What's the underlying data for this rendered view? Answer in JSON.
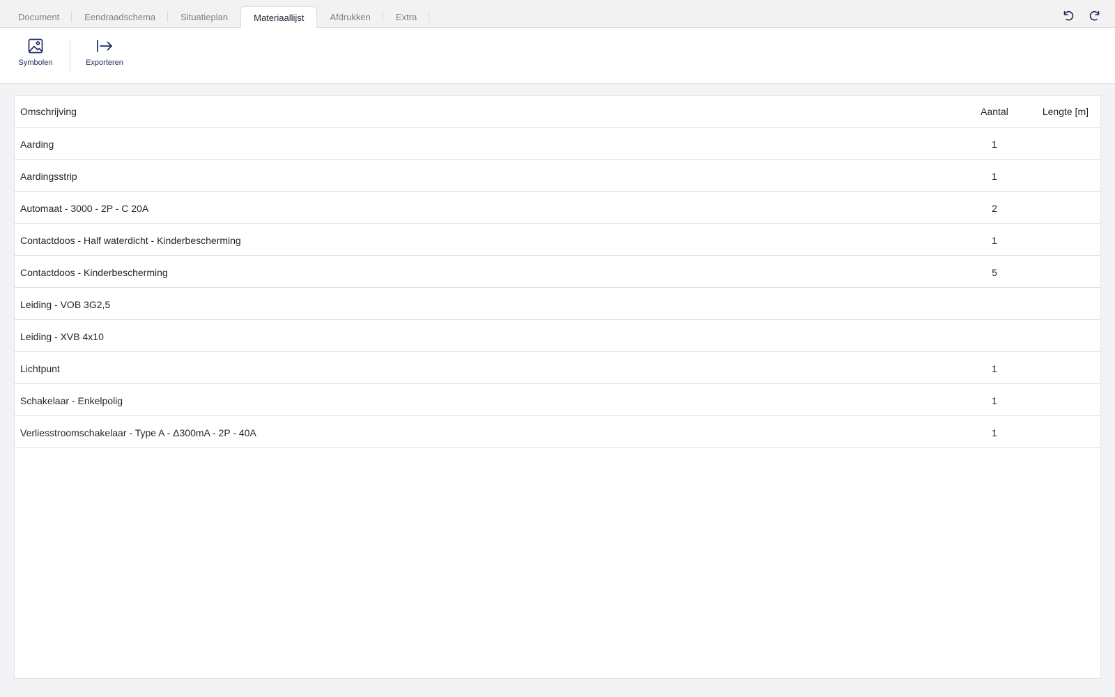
{
  "tabs": [
    {
      "label": "Document",
      "active": false
    },
    {
      "label": "Eendraadschema",
      "active": false
    },
    {
      "label": "Situatieplan",
      "active": false
    },
    {
      "label": "Materiaallijst",
      "active": true
    },
    {
      "label": "Afdrukken",
      "active": false
    },
    {
      "label": "Extra",
      "active": false
    }
  ],
  "history": {
    "undo_icon": "undo-icon",
    "redo_icon": "redo-icon"
  },
  "toolbar": {
    "symbols_label": "Symbolen",
    "symbols_icon": "image-icon",
    "export_label": "Exporteren",
    "export_icon": "export-arrow-icon"
  },
  "table": {
    "columns": {
      "description": "Omschrijving",
      "quantity": "Aantal",
      "length": "Lengte [m]"
    },
    "rows": [
      {
        "description": "Aarding",
        "quantity": "1",
        "length": ""
      },
      {
        "description": "Aardingsstrip",
        "quantity": "1",
        "length": ""
      },
      {
        "description": "Automaat - 3000 - 2P - C 20A",
        "quantity": "2",
        "length": ""
      },
      {
        "description": "Contactdoos - Half waterdicht - Kinderbescherming",
        "quantity": "1",
        "length": ""
      },
      {
        "description": "Contactdoos - Kinderbescherming",
        "quantity": "5",
        "length": ""
      },
      {
        "description": "Leiding - VOB 3G2,5",
        "quantity": "",
        "length": ""
      },
      {
        "description": "Leiding - XVB 4x10",
        "quantity": "",
        "length": ""
      },
      {
        "description": "Lichtpunt",
        "quantity": "1",
        "length": ""
      },
      {
        "description": "Schakelaar - Enkelpolig",
        "quantity": "1",
        "length": ""
      },
      {
        "description": "Verliesstroomschakelaar - Type A - Δ300mA - 2P - 40A",
        "quantity": "1",
        "length": ""
      }
    ]
  },
  "colors": {
    "accent": "#1f2a60",
    "border": "#dcdde1",
    "background": "#f2f3f5"
  }
}
